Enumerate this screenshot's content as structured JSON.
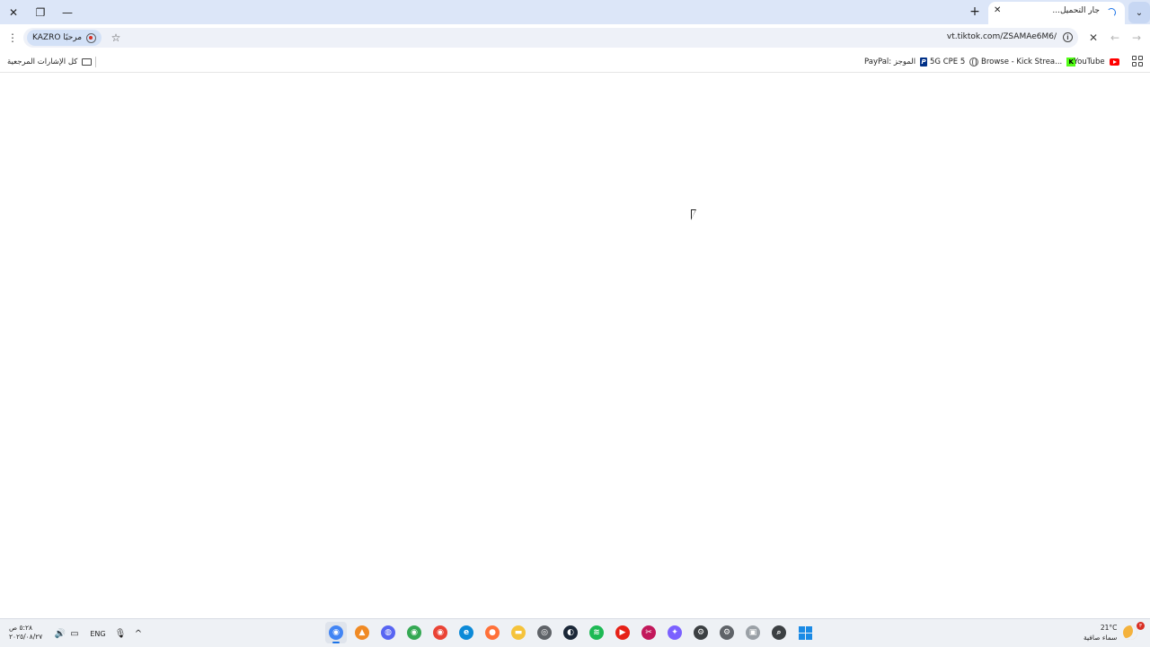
{
  "browser": {
    "tab": {
      "title": "جار التحميل...",
      "close_glyph": "✕"
    },
    "window_controls": {
      "close_glyph": "✕",
      "restore_glyph": "❐",
      "minimize_glyph": "—"
    },
    "new_tab_glyph": "+",
    "tab_search_glyph": "⌄",
    "profile": {
      "label": "مرحبًا KAZRO"
    },
    "address_bar": {
      "url": "vt.tiktok.com/ZSAMAe6M6/"
    },
    "menu_glyph": "⋮",
    "star_glyph": "☆",
    "info_glyph": "i",
    "stop_glyph": "✕",
    "back_glyph": "←",
    "forward_glyph": "→"
  },
  "bookmarks": {
    "all_bookmarks": "كل الإشارات المرجعية",
    "items": [
      {
        "label": "PayPal: الموجز",
        "icon": "paypal-icon"
      },
      {
        "label": "5G CPE 5",
        "icon": "globe-icon"
      },
      {
        "label": "Browse - Kick Strea...",
        "icon": "kick-icon"
      },
      {
        "label": "YouTube",
        "icon": "youtube-icon"
      }
    ],
    "kick_glyph": "K",
    "paypal_glyph": "P"
  },
  "taskbar": {
    "time": "٥:٢٨ ص",
    "date": "٢٠٢٥/٠٨/٢٧",
    "language": "ENG",
    "speaker_glyph": "🔊",
    "network_glyph": "▭",
    "mic_glyph": "🎙",
    "chevron_glyph": "^",
    "weather": {
      "temperature": "21°C",
      "description": "سماء صافية"
    },
    "notification_count": "٣",
    "apps": [
      {
        "name": "chrome",
        "color": "#4285f4",
        "glyph": "◉",
        "active": true
      },
      {
        "name": "vlc",
        "color": "#f08a24",
        "glyph": "▲"
      },
      {
        "name": "discord",
        "color": "#5865f2",
        "glyph": "◍"
      },
      {
        "name": "chrome-2",
        "color": "#34a853",
        "glyph": "◉"
      },
      {
        "name": "chrome-3",
        "color": "#ea4335",
        "glyph": "◉"
      },
      {
        "name": "edge",
        "color": "#0c8ad8",
        "glyph": "e"
      },
      {
        "name": "firefox",
        "color": "#ff7139",
        "glyph": "●"
      },
      {
        "name": "file-explorer",
        "color": "#f5c33b",
        "glyph": "▬"
      },
      {
        "name": "app-badge",
        "color": "#5f6368",
        "glyph": "◎"
      },
      {
        "name": "steam",
        "color": "#1b2838",
        "glyph": "◐"
      },
      {
        "name": "spotify",
        "color": "#1db954",
        "glyph": "≋"
      },
      {
        "name": "youtube-app",
        "color": "#e62117",
        "glyph": "▶"
      },
      {
        "name": "snipping-tool",
        "color": "#c2185b",
        "glyph": "✂"
      },
      {
        "name": "copilot",
        "color": "#7b61ff",
        "glyph": "✦"
      },
      {
        "name": "settings-app",
        "color": "#3c4043",
        "glyph": "⚙"
      },
      {
        "name": "settings-gear",
        "color": "#5f6368",
        "glyph": "⚙"
      },
      {
        "name": "task-view",
        "color": "#9aa0a6",
        "glyph": "▣"
      },
      {
        "name": "search",
        "color": "#3c4043",
        "glyph": "⌕"
      },
      {
        "name": "start",
        "color": "#1a8ae5",
        "glyph": ""
      }
    ]
  }
}
